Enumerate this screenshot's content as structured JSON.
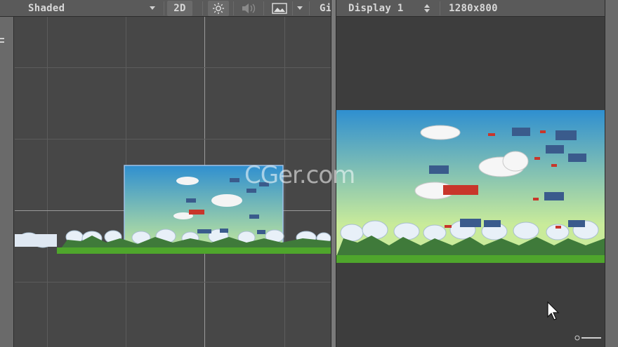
{
  "toolbar": {
    "shading_mode": "Shaded",
    "mode_2d": "2D",
    "gizmos_label": "Gi",
    "display": "Display 1",
    "resolution": "1280x800"
  },
  "icons": [
    "lighting-icon",
    "audio-icon",
    "effects-icon",
    "hamburger-icon",
    "mouse-cursor-icon"
  ],
  "watermark": "CGer.com",
  "colors": {
    "sky_top": "#2f8fd0",
    "sky_bottom": "#c9eb9a",
    "ground": "#4fa62c",
    "panel_bg": "#474747",
    "game_bg": "#3d3d3d"
  }
}
